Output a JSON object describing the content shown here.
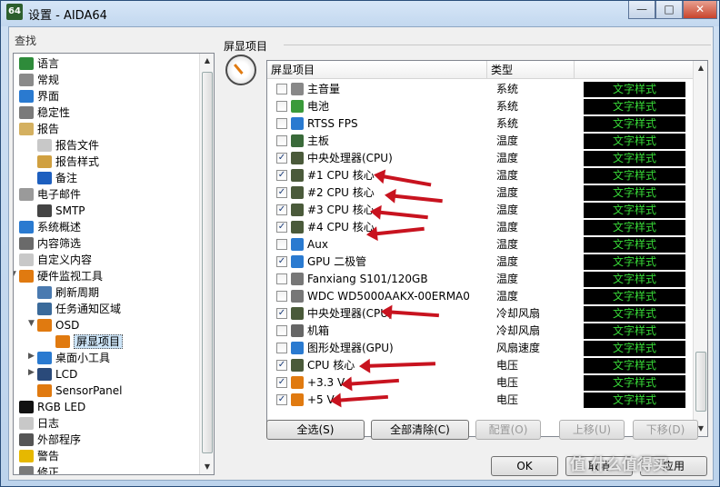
{
  "window": {
    "app_icon": "64",
    "title": "设置 - AIDA64"
  },
  "sidebar": {
    "find_label": "查找",
    "items": [
      {
        "label": "语言",
        "icon": "globe-icon",
        "color": "#2e8b3a"
      },
      {
        "label": "常规",
        "icon": "gear-icon",
        "color": "#8a8a8a"
      },
      {
        "label": "界面",
        "icon": "monitor-icon",
        "color": "#2a7ad0"
      },
      {
        "label": "稳定性",
        "icon": "wrench-icon",
        "color": "#7a7a7a"
      },
      {
        "label": "报告",
        "icon": "report-icon",
        "color": "#d4b060"
      },
      {
        "label": "报告文件",
        "icon": "document-icon",
        "color": "#c8c8c8"
      },
      {
        "label": "报告样式",
        "icon": "document-style-icon",
        "color": "#d0a040"
      },
      {
        "label": "备注",
        "icon": "info-icon",
        "color": "#1d5fbf"
      },
      {
        "label": "电子邮件",
        "icon": "email-icon",
        "color": "#9a9a9a"
      },
      {
        "label": "SMTP",
        "icon": "phone-icon",
        "color": "#444"
      },
      {
        "label": "系统概述",
        "icon": "monitor-icon",
        "color": "#2a7ad0"
      },
      {
        "label": "内容筛选",
        "icon": "filter-icon",
        "color": "#6a6a6a"
      },
      {
        "label": "自定义内容",
        "icon": "document-icon",
        "color": "#c8c8c8"
      },
      {
        "label": "硬件监视工具",
        "icon": "gauge-icon",
        "color": "#e07a10"
      },
      {
        "label": "刷新周期",
        "icon": "calendar-icon",
        "color": "#4a7ab0"
      },
      {
        "label": "任务通知区域",
        "icon": "taskbar-icon",
        "color": "#3a6a9a"
      },
      {
        "label": "OSD",
        "icon": "gauge-icon",
        "color": "#e07a10"
      },
      {
        "label": "屏显项目",
        "icon": "gauge-icon",
        "color": "#e07a10"
      },
      {
        "label": "桌面小工具",
        "icon": "gadget-icon",
        "color": "#2a7ad0"
      },
      {
        "label": "LCD",
        "icon": "lcd-icon",
        "color": "#2a4a7a"
      },
      {
        "label": "SensorPanel",
        "icon": "gauge-icon",
        "color": "#e07a10"
      },
      {
        "label": "RGB LED",
        "icon": "rgb-icon",
        "color": "#111"
      },
      {
        "label": "日志",
        "icon": "log-icon",
        "color": "#c8c8c8"
      },
      {
        "label": "外部程序",
        "icon": "program-icon",
        "color": "#555"
      },
      {
        "label": "警告",
        "icon": "warning-icon",
        "color": "#e6b800"
      },
      {
        "label": "修正",
        "icon": "fix-icon",
        "color": "#7a7a7a"
      }
    ]
  },
  "panel": {
    "title": "屏显项目",
    "columns": {
      "item": "屏显项目",
      "type": "类型",
      "style": ""
    },
    "rows": [
      {
        "checked": false,
        "name": "主音量",
        "type": "系统",
        "style": "文字样式",
        "icon": "speaker-icon",
        "color": "#888"
      },
      {
        "checked": false,
        "name": "电池",
        "type": "系统",
        "style": "文字样式",
        "icon": "battery-icon",
        "color": "#3a9a3a"
      },
      {
        "checked": false,
        "name": "RTSS FPS",
        "type": "系统",
        "style": "文字样式",
        "icon": "monitor-icon",
        "color": "#2a7ad0"
      },
      {
        "checked": false,
        "name": "主板",
        "type": "温度",
        "style": "文字样式",
        "icon": "motherboard-icon",
        "color": "#3a6a3a"
      },
      {
        "checked": true,
        "name": "中央处理器(CPU)",
        "type": "温度",
        "style": "文字样式",
        "icon": "cpu-icon",
        "color": "#4a5a3a"
      },
      {
        "checked": true,
        "name": "#1 CPU 核心",
        "type": "温度",
        "style": "文字样式",
        "icon": "cpu-icon",
        "color": "#4a5a3a"
      },
      {
        "checked": true,
        "name": "#2 CPU 核心",
        "type": "温度",
        "style": "文字样式",
        "icon": "cpu-icon",
        "color": "#4a5a3a"
      },
      {
        "checked": true,
        "name": "#3 CPU 核心",
        "type": "温度",
        "style": "文字样式",
        "icon": "cpu-icon",
        "color": "#4a5a3a"
      },
      {
        "checked": true,
        "name": "#4 CPU 核心",
        "type": "温度",
        "style": "文字样式",
        "icon": "cpu-icon",
        "color": "#4a5a3a"
      },
      {
        "checked": false,
        "name": "Aux",
        "type": "温度",
        "style": "文字样式",
        "icon": "monitor-icon",
        "color": "#2a7ad0"
      },
      {
        "checked": true,
        "name": "GPU 二极管",
        "type": "温度",
        "style": "文字样式",
        "icon": "monitor-icon",
        "color": "#2a7ad0"
      },
      {
        "checked": false,
        "name": "Fanxiang S101/120GB",
        "type": "温度",
        "style": "文字样式",
        "icon": "drive-icon",
        "color": "#777"
      },
      {
        "checked": false,
        "name": "WDC WD5000AAKX-00ERMA0",
        "type": "温度",
        "style": "文字样式",
        "icon": "drive-icon",
        "color": "#777"
      },
      {
        "checked": true,
        "name": "中央处理器(CPU)",
        "type": "冷却风扇",
        "style": "文字样式",
        "icon": "cpu-icon",
        "color": "#4a5a3a"
      },
      {
        "checked": false,
        "name": "机箱",
        "type": "冷却风扇",
        "style": "文字样式",
        "icon": "chassis-icon",
        "color": "#666"
      },
      {
        "checked": false,
        "name": "图形处理器(GPU)",
        "type": "风扇速度",
        "style": "文字样式",
        "icon": "monitor-icon",
        "color": "#2a7ad0"
      },
      {
        "checked": true,
        "name": "CPU 核心",
        "type": "电压",
        "style": "文字样式",
        "icon": "cpu-icon",
        "color": "#4a5a3a"
      },
      {
        "checked": true,
        "name": "+3.3 V",
        "type": "电压",
        "style": "文字样式",
        "icon": "voltage-icon",
        "color": "#e07a10"
      },
      {
        "checked": true,
        "name": "+5 V",
        "type": "电压",
        "style": "文字样式",
        "icon": "voltage-icon",
        "color": "#e07a10"
      }
    ]
  },
  "buttons": {
    "select_all": "全选(S)",
    "clear_all": "全部清除(C)",
    "config": "配置(O)",
    "move_up": "上移(U)",
    "move_down": "下移(D)",
    "ok": "OK",
    "cancel": "取消",
    "apply": "应用"
  },
  "watermark": "值 什么值得买",
  "colors": {
    "style_bg": "#000000",
    "style_fg": "#37d937",
    "annotation_arrow": "#c8131f"
  }
}
